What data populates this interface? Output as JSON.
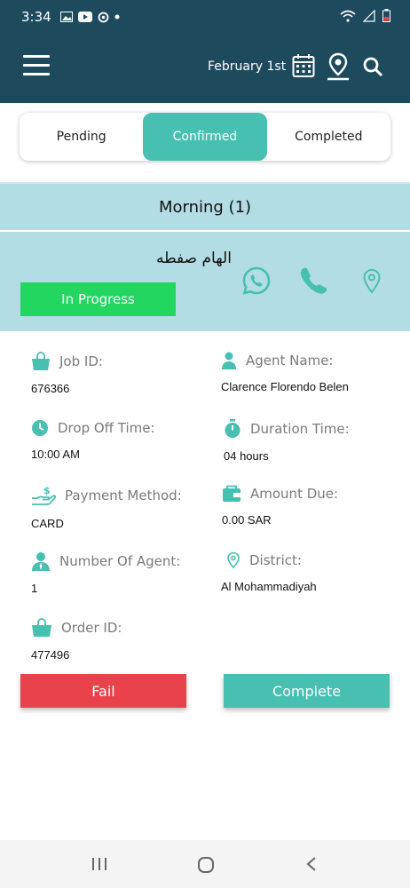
{
  "status_bar": {
    "time": "3:34",
    "icons": [
      "image-icon",
      "youtube-icon",
      "sync-icon",
      "dot-icon",
      "wifi-icon",
      "signal-icon",
      "battery-icon"
    ]
  },
  "app_bar": {
    "date": "February 1st",
    "icons": [
      "menu-icon",
      "calendar-icon",
      "map-pin-icon",
      "search-icon"
    ]
  },
  "tabs": [
    {
      "label": "Pending",
      "active": false
    },
    {
      "label": "Confirmed",
      "active": true
    },
    {
      "label": "Completed",
      "active": false
    }
  ],
  "section": {
    "title": "Morning (1)"
  },
  "job": {
    "customer_name": "الهام صفطه",
    "status": "In Progress",
    "fields": {
      "job_id": {
        "label": "Job ID:",
        "value": "676366",
        "icon": "shopping-bag-icon"
      },
      "agent_name": {
        "label": "Agent Name:",
        "value": "Clarence Florendo Belen",
        "icon": "person-icon"
      },
      "drop_off_time": {
        "label": "Drop Off Time:",
        "value": "10:00 AM",
        "icon": "clock-icon"
      },
      "duration_time": {
        "label": "Duration Time:",
        "value": "04 hours",
        "icon": "stopwatch-icon"
      },
      "payment_method": {
        "label": "Payment Method:",
        "value": "CARD",
        "icon": "payment-hand-icon"
      },
      "amount_due": {
        "label": "Amount Due:",
        "value": "0.00 SAR",
        "icon": "wallet-icon"
      },
      "number_of_agent": {
        "label": "Number Of Agent:",
        "value": "1",
        "icon": "agent-icon"
      },
      "district": {
        "label": "District:",
        "value": "Al Mohammadiyah",
        "icon": "location-pin-icon"
      },
      "order_id": {
        "label": "Order ID:",
        "value": "477496",
        "icon": "shopping-bag-icon"
      }
    }
  },
  "actions": {
    "fail_label": "Fail",
    "complete_label": "Complete"
  },
  "colors": {
    "header": "#1e4a5e",
    "accent": "#47bfb1",
    "section_bg": "#b3dde5",
    "in_progress": "#22d660",
    "fail": "#e9424a"
  }
}
